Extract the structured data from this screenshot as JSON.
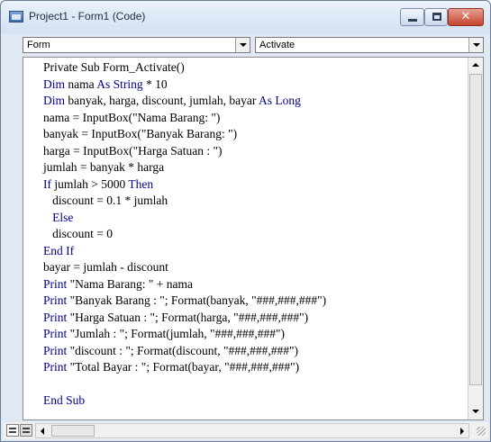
{
  "window": {
    "title": "Project1 - Form1 (Code)",
    "close_glyph": "✕"
  },
  "dropdowns": {
    "object_value": "Form",
    "procedure_value": "Activate"
  },
  "code": {
    "lines": [
      [
        {
          "t": "Private Sub Form_Activate()",
          "k": false
        }
      ],
      [
        {
          "t": "Dim",
          "k": true
        },
        {
          "t": " nama ",
          "k": false
        },
        {
          "t": "As String",
          "k": true
        },
        {
          "t": " * 10",
          "k": false
        }
      ],
      [
        {
          "t": "Dim",
          "k": true
        },
        {
          "t": " banyak, harga, discount, jumlah, bayar ",
          "k": false
        },
        {
          "t": "As Long",
          "k": true
        }
      ],
      [
        {
          "t": "nama = InputBox(\"Nama Barang: \")",
          "k": false
        }
      ],
      [
        {
          "t": "banyak = InputBox(\"Banyak Barang: \")",
          "k": false
        }
      ],
      [
        {
          "t": "harga = InputBox(\"Harga Satuan : \")",
          "k": false
        }
      ],
      [
        {
          "t": "jumlah = banyak * harga",
          "k": false
        }
      ],
      [
        {
          "t": "If",
          "k": true
        },
        {
          "t": " jumlah > 5000 ",
          "k": false
        },
        {
          "t": "Then",
          "k": true
        }
      ],
      [
        {
          "t": "   discount = 0.1 * jumlah",
          "k": false
        }
      ],
      [
        {
          "t": "   ",
          "k": false
        },
        {
          "t": "Else",
          "k": true
        }
      ],
      [
        {
          "t": "   discount = 0",
          "k": false
        }
      ],
      [
        {
          "t": "End If",
          "k": true
        }
      ],
      [
        {
          "t": "bayar = jumlah - discount",
          "k": false
        }
      ],
      [
        {
          "t": "Print",
          "k": true
        },
        {
          "t": " \"Nama Barang: \" + nama",
          "k": false
        }
      ],
      [
        {
          "t": "Print",
          "k": true
        },
        {
          "t": " \"Banyak Barang : \"; Format(banyak, \"###,###,###\")",
          "k": false
        }
      ],
      [
        {
          "t": "Print",
          "k": true
        },
        {
          "t": " \"Harga Satuan : \"; Format(harga, \"###,###,###\")",
          "k": false
        }
      ],
      [
        {
          "t": "Print",
          "k": true
        },
        {
          "t": " \"Jumlah : \"; Format(jumlah, \"###,###,###\")",
          "k": false
        }
      ],
      [
        {
          "t": "Print",
          "k": true
        },
        {
          "t": " \"discount : \"; Format(discount, \"###,###,###\")",
          "k": false
        }
      ],
      [
        {
          "t": "Print",
          "k": true
        },
        {
          "t": " \"Total Bayar : \"; Format(bayar, \"###,###,###\")",
          "k": false
        }
      ],
      [
        {
          "t": "",
          "k": false
        }
      ],
      [
        {
          "t": "End Sub",
          "k": true
        }
      ]
    ]
  },
  "colors": {
    "keyword": "#00008b",
    "text": "#000000"
  }
}
